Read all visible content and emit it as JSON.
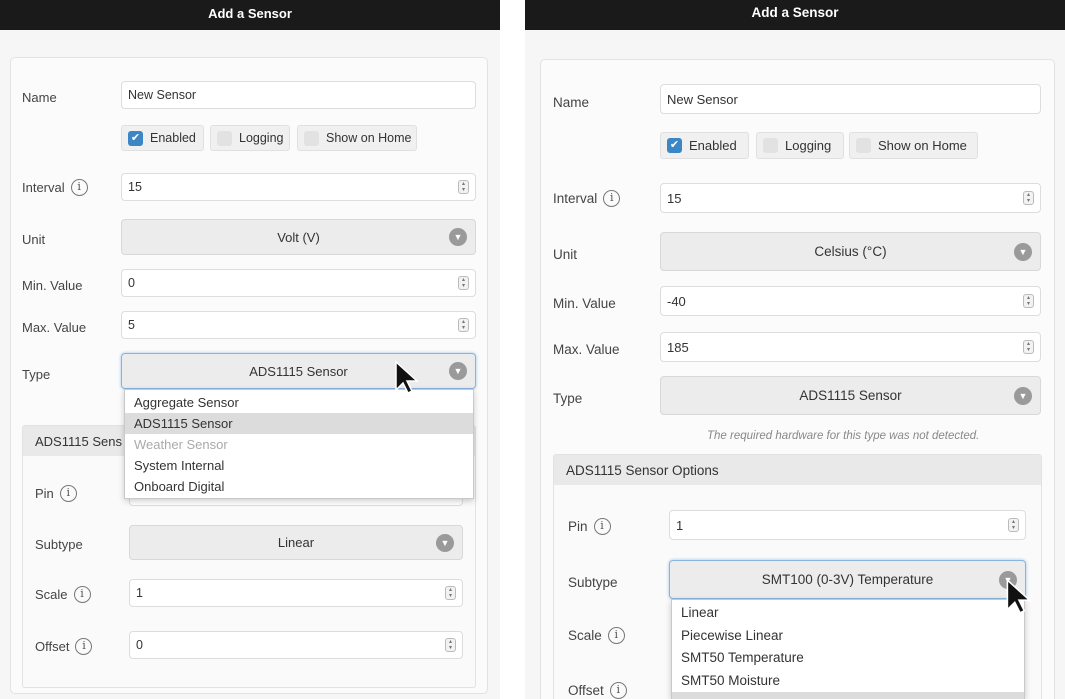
{
  "left": {
    "title": "Add a Sensor",
    "name_label": "Name",
    "name_value": "New Sensor",
    "enabled_label": "Enabled",
    "logging_label": "Logging",
    "home_label": "Show on Home",
    "interval_label": "Interval",
    "interval_value": "15",
    "unit_label": "Unit",
    "unit_value": "Volt (V)",
    "min_label": "Min. Value",
    "min_value": "0",
    "max_label": "Max. Value",
    "max_value": "5",
    "type_label": "Type",
    "type_value": "ADS1115 Sensor",
    "type_options": [
      "Aggregate Sensor",
      "ADS1115 Sensor",
      "Weather Sensor",
      "System Internal",
      "Onboard Digital"
    ],
    "options_title": "ADS1115 Sens",
    "pin_label": "Pin",
    "subtype_label": "Subtype",
    "subtype_value": "Linear",
    "scale_label": "Scale",
    "scale_value": "1",
    "offset_label": "Offset",
    "offset_value": "0"
  },
  "right": {
    "title": "Add a Sensor",
    "name_label": "Name",
    "name_value": "New Sensor",
    "enabled_label": "Enabled",
    "logging_label": "Logging",
    "home_label": "Show on Home",
    "interval_label": "Interval",
    "interval_value": "15",
    "unit_label": "Unit",
    "unit_value": "Celsius (°C)",
    "min_label": "Min. Value",
    "min_value": "-40",
    "max_label": "Max. Value",
    "max_value": "185",
    "type_label": "Type",
    "type_value": "ADS1115 Sensor",
    "hardware_note": "The required hardware for this type was not detected.",
    "options_title": "ADS1115 Sensor Options",
    "pin_label": "Pin",
    "pin_value": "1",
    "subtype_label": "Subtype",
    "subtype_value": "SMT100 (0-3V) Temperature",
    "subtype_options": [
      "Linear",
      "Piecewise Linear",
      "SMT50 Temperature",
      "SMT50 Moisture"
    ],
    "scale_label": "Scale",
    "offset_label": "Offset"
  },
  "icons": {
    "info": "info-icon",
    "chevron": "chevron-down-icon",
    "checkmark": "checkmark-icon",
    "cursor": "mouse-cursor-icon"
  },
  "colors": {
    "titlebar": "#1a1a1a",
    "checkbox_on": "#3d86c6",
    "highlight": "#dcdcdc"
  }
}
